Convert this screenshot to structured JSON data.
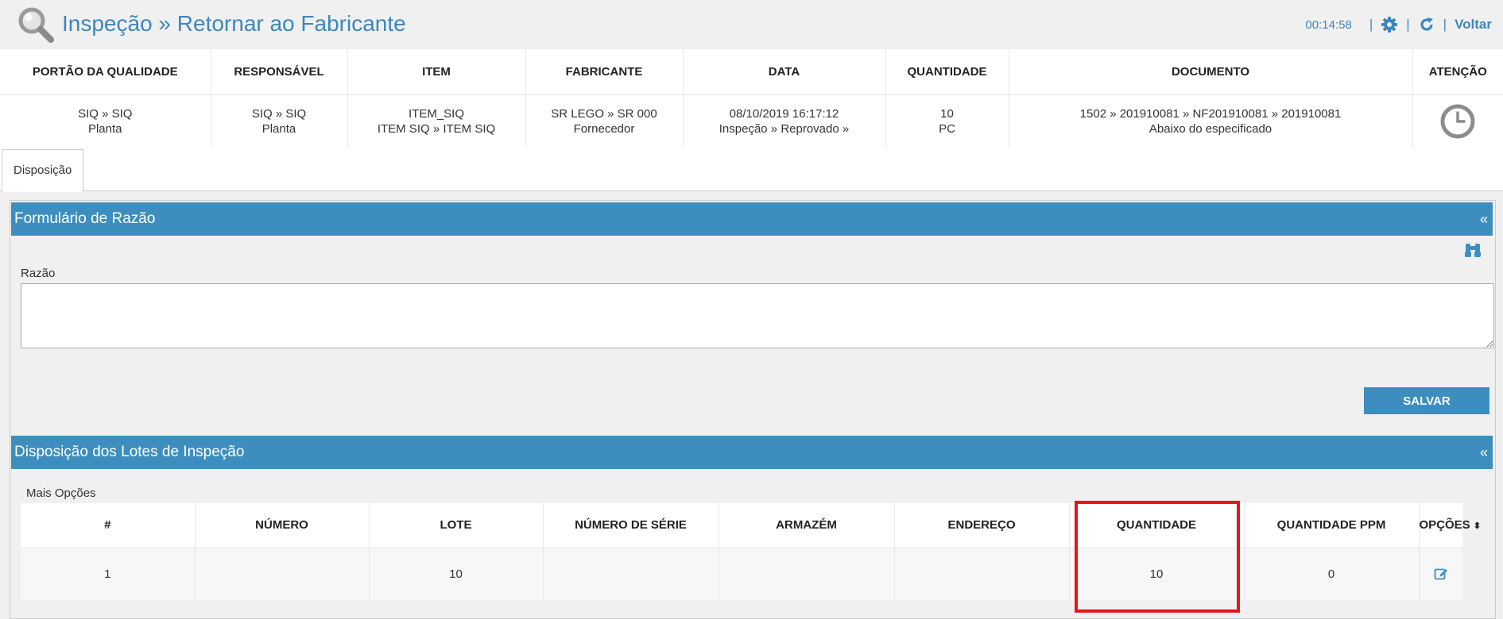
{
  "header": {
    "title": "Inspeção » Retornar ao Fabricante",
    "timer": "00:14:58",
    "back_label": "Voltar",
    "separator": "|"
  },
  "summary": {
    "columns": [
      "PORTÃO DA QUALIDADE",
      "RESPONSÁVEL",
      "ITEM",
      "FABRICANTE",
      "DATA",
      "QUANTIDADE",
      "DOCUMENTO",
      "ATENÇÃO"
    ],
    "row": [
      [
        "SIQ » SIQ",
        "Planta"
      ],
      [
        "SIQ » SIQ",
        "Planta"
      ],
      [
        "ITEM_SIQ",
        "ITEM SIQ » ITEM SIQ"
      ],
      [
        "SR LEGO » SR 000",
        "Fornecedor"
      ],
      [
        "08/10/2019 16:17:12",
        "Inspeção » Reprovado »"
      ],
      [
        "10",
        "PC"
      ],
      [
        "1502 » 201910081 » NF201910081 » 201910081",
        "Abaixo do especificado"
      ]
    ]
  },
  "tabs": [
    {
      "label": "Disposição"
    }
  ],
  "reason_panel": {
    "title": "Formulário de Razão",
    "collapse": "«",
    "field_label": "Razão",
    "field_value": "",
    "save_label": "SALVAR"
  },
  "lots_panel": {
    "title": "Disposição dos Lotes de Inspeção",
    "collapse": "«",
    "more_options": "Mais Opções",
    "columns": [
      "#",
      "NÚMERO",
      "LOTE",
      "NÚMERO DE SÉRIE",
      "ARMAZÉM",
      "ENDEREÇO",
      "QUANTIDADE",
      "QUANTIDADE PPM",
      "OPÇÕES"
    ],
    "sort_glyph": "⬍",
    "rows": [
      {
        "index": "1",
        "number": "",
        "lot": "10",
        "serial": "",
        "warehouse": "",
        "address": "",
        "quantity": "10",
        "ppm": "0"
      }
    ]
  },
  "colors": {
    "accent": "#3d8ebf",
    "title": "#3d87bb",
    "highlight": "#e8141c"
  },
  "icons": [
    "magnifier-icon",
    "gear-icon",
    "refresh-icon",
    "clock-icon",
    "binoculars-icon",
    "edit-icon"
  ]
}
